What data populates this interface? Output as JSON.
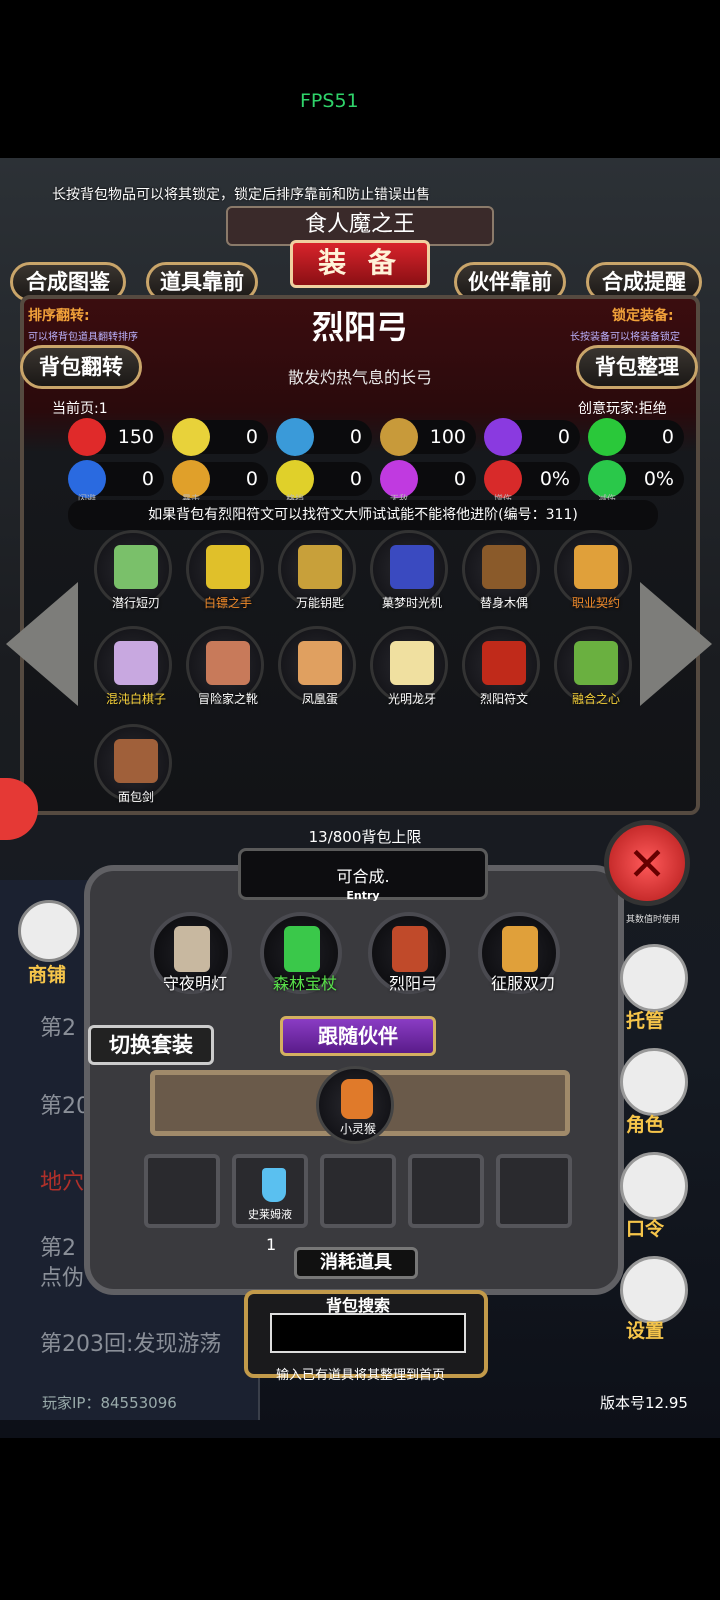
{
  "fps": "FPS51",
  "tip": "长按背包物品可以将其锁定，锁定后排序靠前和防止错误出售",
  "banner": {
    "title": "食人魔之王",
    "main": "装 备"
  },
  "top_buttons": [
    "合成图鉴",
    "道具靠前",
    "伙伴靠前",
    "合成提醒"
  ],
  "sort_flip": {
    "title": "排序翻转:",
    "sub": "可以将背包道具翻转排序"
  },
  "lock_equip": {
    "title": "锁定装备:",
    "sub": "长按装备可以将装备锁定"
  },
  "side_buttons": [
    "背包翻转",
    "背包整理"
  ],
  "item": {
    "name": "烈阳弓",
    "desc": "散发灼热气息的长弓"
  },
  "page": "当前页:1",
  "creative": "创意玩家:拒绝",
  "stats": [
    {
      "icon": "heart-icon",
      "value": "150",
      "color": "#e02a2a",
      "caption": ""
    },
    {
      "icon": "armor-icon",
      "value": "0",
      "color": "#e8d23a",
      "caption": ""
    },
    {
      "icon": "helmet-icon",
      "value": "0",
      "color": "#3a9ad9",
      "caption": ""
    },
    {
      "icon": "sword-icon",
      "value": "100",
      "color": "#c89a3a",
      "caption": ""
    },
    {
      "icon": "bolt-icon",
      "value": "0",
      "color": "#8a3ae0",
      "caption": ""
    },
    {
      "icon": "clover-icon",
      "value": "0",
      "color": "#2ac83a",
      "caption": ""
    },
    {
      "icon": "dodge-icon",
      "value": "0",
      "color": "#2a6ae0",
      "caption": "闪避"
    },
    {
      "icon": "crit-icon",
      "value": "0",
      "color": "#e0a02a",
      "caption": "暴击"
    },
    {
      "icon": "block-icon",
      "value": "0",
      "color": "#e0d02a",
      "caption": "格挡"
    },
    {
      "icon": "invincible-icon",
      "value": "0",
      "color": "#c03ae0",
      "caption": "无敌"
    },
    {
      "icon": "dmg-up-icon",
      "value": "0%",
      "color": "#d82a2a",
      "caption": "增伤"
    },
    {
      "icon": "dmg-down-icon",
      "value": "0%",
      "color": "#2ac84a",
      "caption": "减伤"
    }
  ],
  "hint": "如果背包有烈阳符文可以找符文大师试试能不能将他进阶(编号：311)",
  "inventory": [
    {
      "label": "潜行短刃",
      "cls": "",
      "color": "#7ac06a"
    },
    {
      "label": "白镖之手",
      "cls": "orange",
      "color": "#e0c02a"
    },
    {
      "label": "万能钥匙",
      "cls": "",
      "color": "#c8a03a"
    },
    {
      "label": "菓梦时光机",
      "cls": "",
      "color": "#3a4ac0"
    },
    {
      "label": "替身木偶",
      "cls": "",
      "color": "#8a5a2a"
    },
    {
      "label": "职业契约",
      "cls": "orange",
      "color": "#e0a03a"
    },
    {
      "label": "混沌白棋子",
      "cls": "yellow",
      "color": "#c8a8e0"
    },
    {
      "label": "冒险家之靴",
      "cls": "",
      "color": "#c87a5a"
    },
    {
      "label": "凤凰蛋",
      "cls": "",
      "color": "#e0a060"
    },
    {
      "label": "光明龙牙",
      "cls": "",
      "color": "#f0e0a0"
    },
    {
      "label": "烈阳符文",
      "cls": "",
      "color": "#c02a1a"
    },
    {
      "label": "融合之心",
      "cls": "yellow",
      "color": "#6ab040"
    },
    {
      "label": "面包剑",
      "cls": "",
      "color": "#a0603a"
    }
  ],
  "capacity": "13/800背包上限",
  "synth": {
    "text": "可合成.",
    "entry": "Entry"
  },
  "equipped": [
    {
      "label": "守夜明灯",
      "cls": "",
      "color": "#c8b8a0"
    },
    {
      "label": "森林宝杖",
      "cls": "green",
      "color": "#3ac84a"
    },
    {
      "label": "烈阳弓",
      "cls": "",
      "color": "#c04a2a"
    },
    {
      "label": "征服双刀",
      "cls": "",
      "color": "#e0a03a"
    }
  ],
  "switch_set": "切换套装",
  "follow_partner": "跟随伙伴",
  "partner": "小灵猴",
  "consumable": {
    "label": "史莱姆液",
    "qty": "1"
  },
  "consumable_button": "消耗道具",
  "search": {
    "label": "背包搜索",
    "placeholder": "",
    "hint": "输入已有道具将其整理到首页"
  },
  "right_menu": [
    "托管",
    "角色",
    "口令",
    "设置"
  ],
  "shop": "商铺",
  "story": [
    "第2",
    "第20",
    "地穴",
    "第2",
    "点伪",
    "第203回:发现游荡"
  ],
  "overlay_small": "其数值时使用",
  "footer": {
    "ip": "玩家IP：84553096",
    "version": "版本号12.95"
  }
}
